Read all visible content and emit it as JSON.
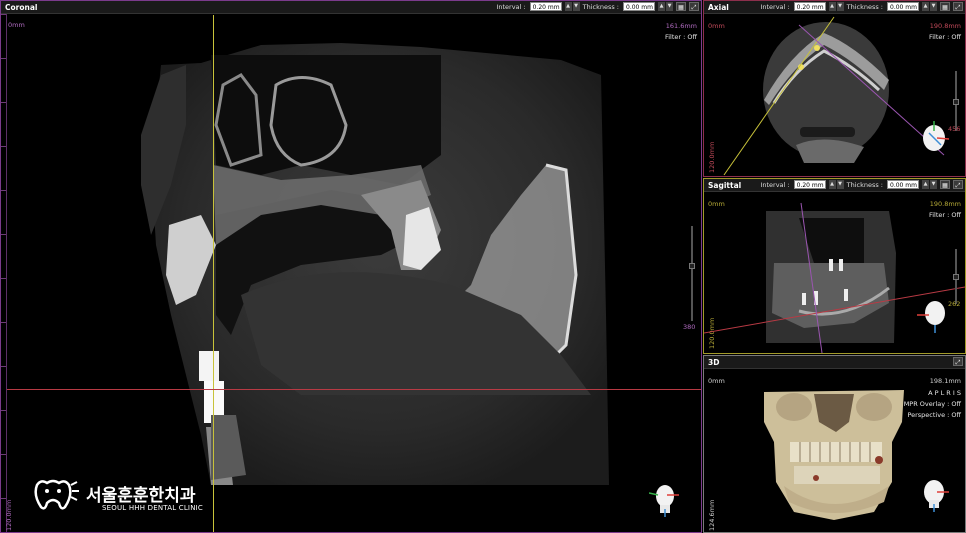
{
  "colors": {
    "coronal_border": "#7b3b8c",
    "axial_border": "#8c2f4c",
    "sagittal_border": "#a29a2a",
    "crosshair_yellow": "#c8c23a",
    "crosshair_red": "#b83a44"
  },
  "coronal": {
    "title": "Coronal",
    "interval_label": "Interval :",
    "interval_value": "0.20 mm",
    "thickness_label": "Thickness :",
    "thickness_value": "0.00 mm",
    "top_left_mm": "0mm",
    "top_right_mm": "161.6mm",
    "bottom_left_mm": "120.0mm",
    "filter": "Filter : Off",
    "slider_value": "380"
  },
  "axial": {
    "title": "Axial",
    "interval_label": "Interval :",
    "interval_value": "0.20 mm",
    "thickness_label": "Thickness :",
    "thickness_value": "0.00 mm",
    "top_left_mm": "0mm",
    "top_right_mm": "190.8mm",
    "bottom_left_mm": "120.0mm",
    "filter": "Filter : Off",
    "slider_value": "456"
  },
  "sagittal": {
    "title": "Sagittal",
    "interval_label": "Interval :",
    "interval_value": "0.20 mm",
    "thickness_label": "Thickness :",
    "thickness_value": "0.00 mm",
    "top_left_mm": "0mm",
    "top_right_mm": "190.8mm",
    "bottom_left_mm": "120.0mm",
    "filter": "Filter : Off",
    "slider_value": "262"
  },
  "view3d": {
    "title": "3D",
    "top_left_mm": "0mm",
    "top_right_mm": "198.1mm",
    "bottom_left_mm": "124.6mm",
    "aplris": "A P L R I S",
    "mpr_overlay": "MPR Overlay : Off",
    "perspective": "Perspective : Off"
  },
  "logo": {
    "korean": "서울훈훈한치과",
    "english": "SEOUL HHH DENTAL CLINIC"
  },
  "icons": {
    "grid": "grid-icon",
    "maximize": "maximize-icon",
    "head_orientation": "head-orientation-icon"
  }
}
